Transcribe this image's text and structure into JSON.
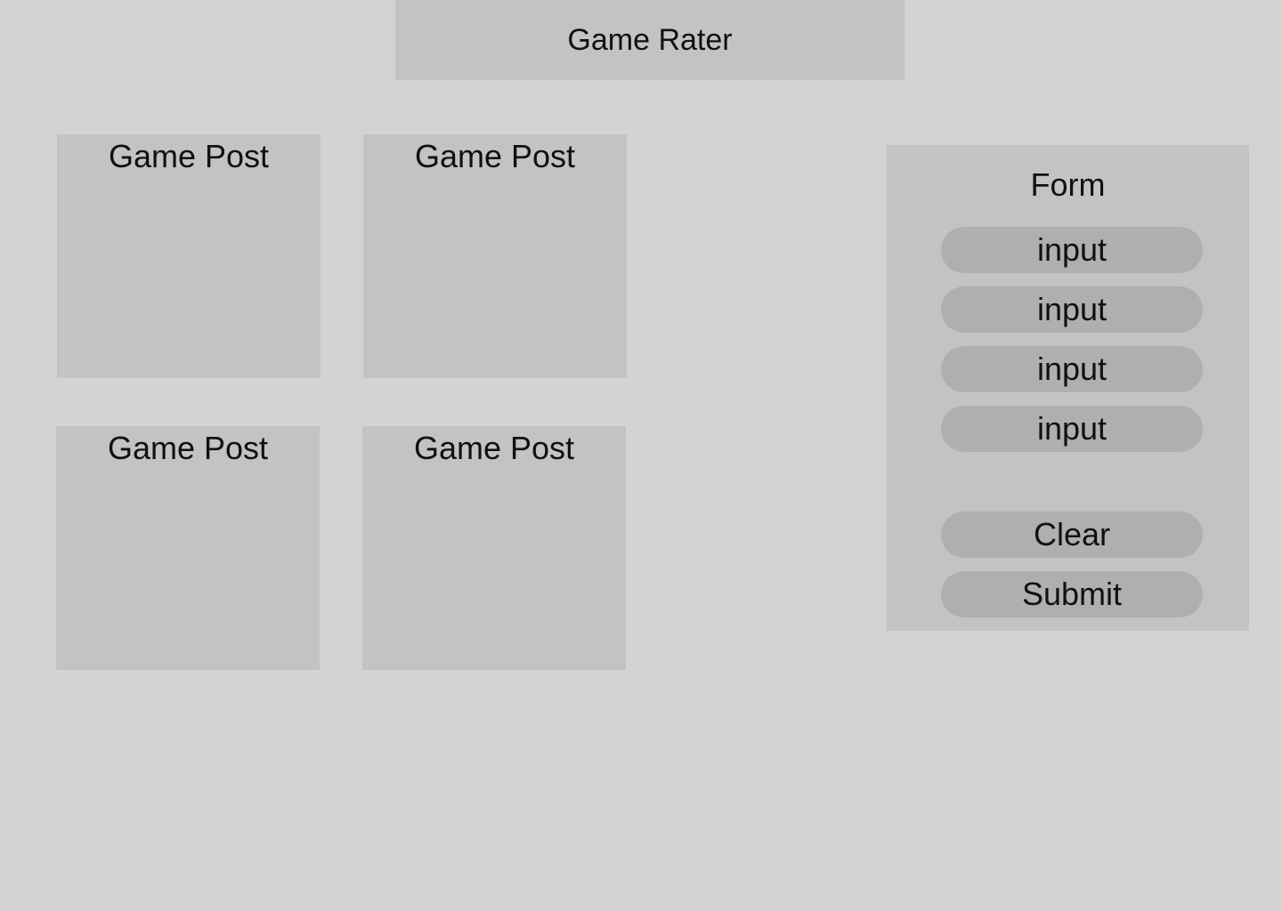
{
  "header": {
    "title": "Game Rater"
  },
  "posts": [
    {
      "title": "Game Post"
    },
    {
      "title": "Game Post"
    },
    {
      "title": "Game Post"
    },
    {
      "title": "Game Post"
    }
  ],
  "form": {
    "title": "Form",
    "inputs": [
      {
        "placeholder": "input"
      },
      {
        "placeholder": "input"
      },
      {
        "placeholder": "input"
      },
      {
        "placeholder": "input"
      }
    ],
    "clear_label": "Clear",
    "submit_label": "Submit"
  },
  "colors": {
    "background": "#d4d2d3",
    "panel": "#c3c3c3",
    "control": "#afafaf",
    "text": "#111111"
  }
}
